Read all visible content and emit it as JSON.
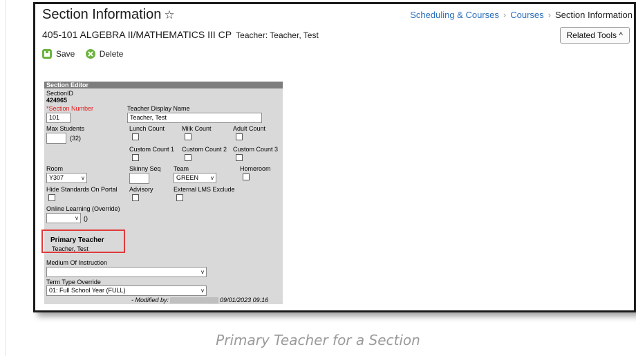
{
  "header": {
    "title": "Section Information",
    "subtitle": "405-101 ALGEBRA II/MATHEMATICS III CP",
    "teacher": "Teacher: Teacher, Test",
    "related_tools": "Related Tools"
  },
  "breadcrumb": [
    "Scheduling & Courses",
    "Courses",
    "Section Information"
  ],
  "toolbar": {
    "save": "Save",
    "delete": "Delete"
  },
  "editor": {
    "heading": "Section Editor",
    "section_id_label": "SectionID",
    "section_id_value": "424965",
    "section_number_label": "*Section Number",
    "section_number_value": "101",
    "teacher_display_label": "Teacher Display Name",
    "teacher_display_value": "Teacher, Test",
    "max_students_label": "Max Students",
    "max_students_note": "(32)",
    "lunch_count": "Lunch Count",
    "milk_count": "Milk Count",
    "adult_count": "Adult Count",
    "custom1": "Custom Count 1",
    "custom2": "Custom Count 2",
    "custom3": "Custom Count 3",
    "room_label": "Room",
    "room_value": "Y307",
    "skinny_seq": "Skinny Seq",
    "team_label": "Team",
    "team_value": "GREEN",
    "homeroom": "Homeroom",
    "hide_standards": "Hide Standards On Portal",
    "advisory": "Advisory",
    "external_lms": "External LMS Exclude",
    "online_learning": "Online Learning (Override)",
    "online_paren": "()",
    "primary_teacher_label": "Primary Teacher",
    "primary_teacher_value": "Teacher, Test",
    "medium_label": "Medium Of Instruction",
    "term_type_label": "Term Type Override",
    "term_type_value": "01: Full School Year (FULL)",
    "modified_by": "- Modified by:",
    "modified_tail": "09/01/2023 09:16"
  },
  "caption": "Primary Teacher for a Section"
}
